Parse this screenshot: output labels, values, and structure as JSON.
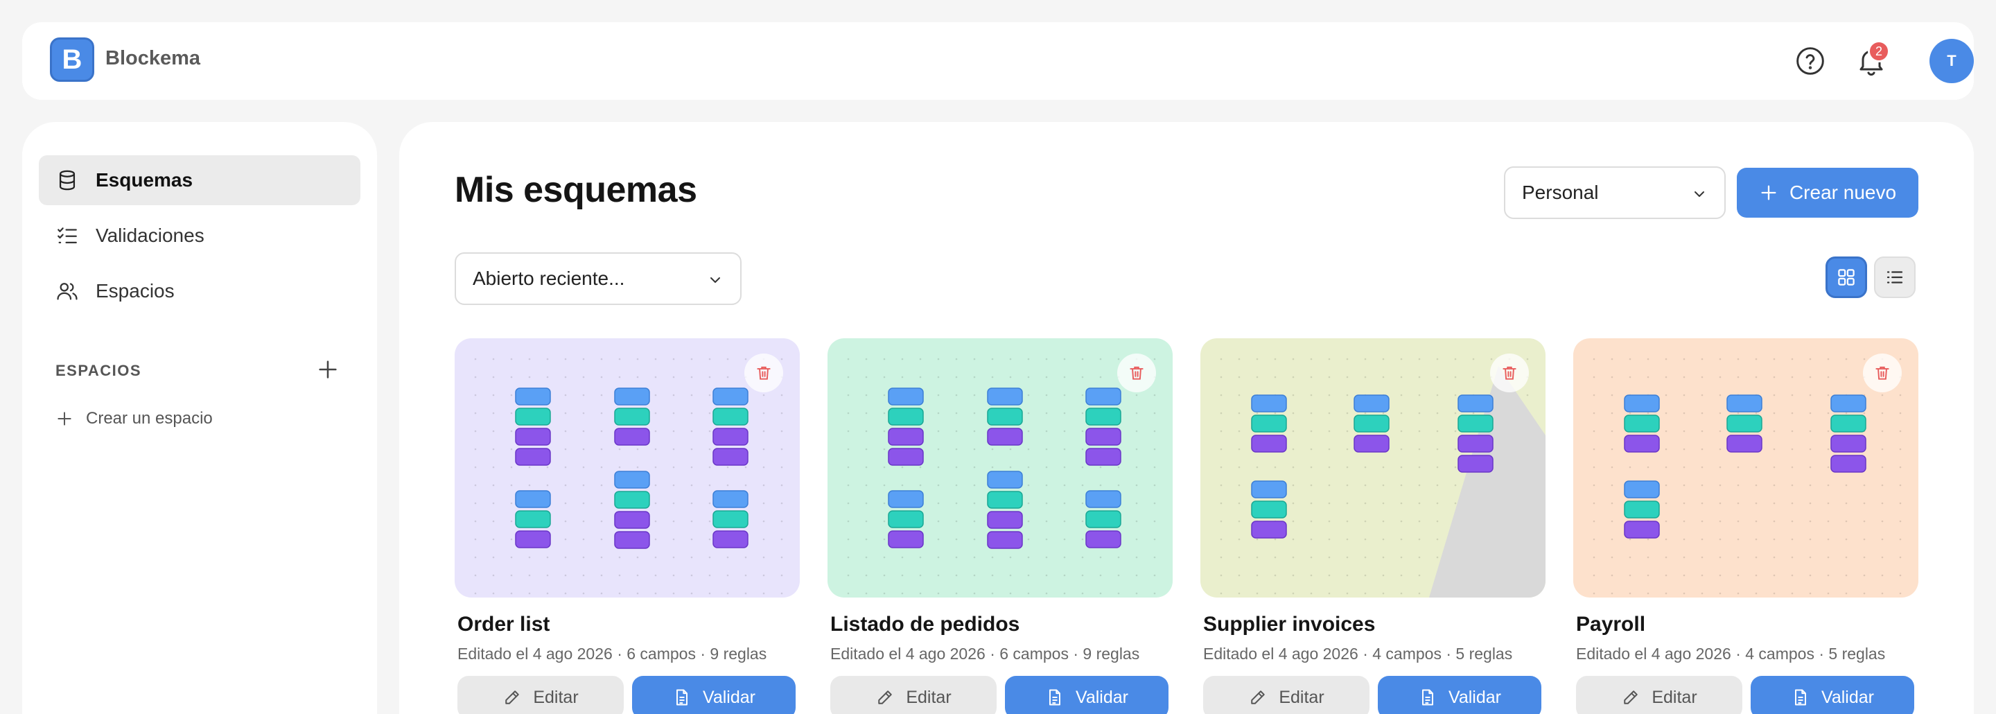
{
  "app": {
    "logo_letter": "B",
    "name": "Blockema"
  },
  "header": {
    "notification_count": "2",
    "avatar_initial": "T"
  },
  "sidebar": {
    "items": [
      {
        "label": "Esquemas",
        "icon": "database-icon",
        "active": true
      },
      {
        "label": "Validaciones",
        "icon": "checklist-icon",
        "active": false
      },
      {
        "label": "Espacios",
        "icon": "users-icon",
        "active": false
      }
    ],
    "section_title": "ESPACIOS",
    "create_space_label": "Crear un espacio"
  },
  "main": {
    "title": "Mis esquemas",
    "scope_select": "Personal",
    "create_button": "Crear nuevo",
    "sort_select": "Abierto reciente...",
    "view_mode": "grid"
  },
  "cards": [
    {
      "title": "Order list",
      "meta": "Editado el 4 ago 2026 · 6 campos · 9 reglas",
      "edit_label": "Editar",
      "validate_label": "Validar",
      "bg": "#e8e4fc"
    },
    {
      "title": "Listado de pedidos",
      "meta": "Editado el 4 ago 2026 · 6 campos · 9 reglas",
      "edit_label": "Editar",
      "validate_label": "Validar",
      "bg": "#cdf3e1"
    },
    {
      "title": "Supplier invoices",
      "meta": "Editado el 4 ago 2026 · 4 campos · 5 reglas",
      "edit_label": "Editar",
      "validate_label": "Validar",
      "bg": "#eaefcd"
    },
    {
      "title": "Payroll",
      "meta": "Editado el 4 ago 2026 · 4 campos · 5 reglas",
      "edit_label": "Editar",
      "validate_label": "Validar",
      "bg": "#fde1cc"
    }
  ],
  "colors": {
    "accent": "#4a8ae6",
    "block_blue": "#5aa0f5",
    "block_teal": "#2dd1bd",
    "block_purple": "#8c55ea",
    "danger": "#e85c5c"
  }
}
